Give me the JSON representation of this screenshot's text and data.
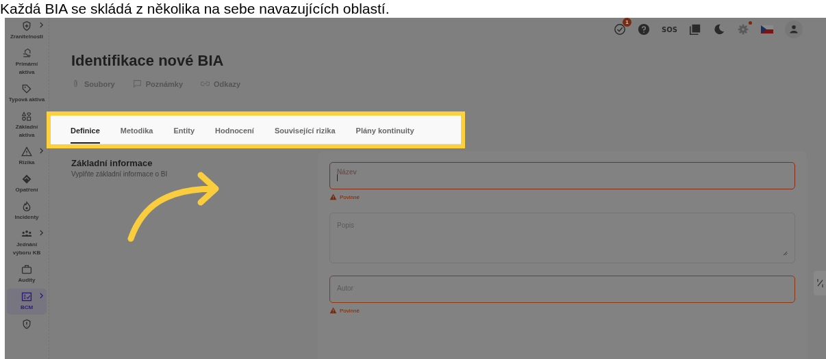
{
  "caption": "Každá BIA se skládá z několika na sebe navazujících oblastí.",
  "sidebar": {
    "items": [
      {
        "label": "Zranitelnosti",
        "kind": "shield-plus",
        "expandable": true,
        "selected": false
      },
      {
        "label": "Primární aktiva",
        "kind": "hand-house",
        "expandable": false,
        "selected": false
      },
      {
        "label": "Typová aktiva",
        "kind": "tag",
        "expandable": false,
        "selected": false
      },
      {
        "label": "Základní aktiva",
        "kind": "shapes",
        "expandable": false,
        "selected": false
      },
      {
        "label": "Rizika",
        "kind": "warning",
        "expandable": true,
        "selected": false
      },
      {
        "label": "Opatření",
        "kind": "handshake",
        "expandable": false,
        "selected": false
      },
      {
        "label": "Incidenty",
        "kind": "flame",
        "expandable": false,
        "selected": false
      },
      {
        "label": "Jednání výboru KB",
        "kind": "people",
        "expandable": true,
        "selected": false
      },
      {
        "label": "Audity",
        "kind": "briefcase",
        "expandable": false,
        "selected": false
      },
      {
        "label": "BCM",
        "kind": "checklist",
        "expandable": true,
        "selected": true
      },
      {
        "kind": "shield-alert",
        "expandable": false,
        "selected": false
      }
    ]
  },
  "topbar": {
    "tasks_badge": "1",
    "sos": "SOS",
    "settings_notification": true
  },
  "page": {
    "title": "Identifikace nové BIA",
    "links": [
      {
        "label": "Soubory",
        "kind": "paperclip"
      },
      {
        "label": "Poznámky",
        "kind": "comment"
      },
      {
        "label": "Odkazy",
        "kind": "link"
      }
    ]
  },
  "tabs": [
    {
      "label": "Definice",
      "selected": true
    },
    {
      "label": "Metodika",
      "selected": false
    },
    {
      "label": "Entity",
      "selected": false
    },
    {
      "label": "Hodnocení",
      "selected": false
    },
    {
      "label": "Související rizika",
      "selected": false
    },
    {
      "label": "Plány kontinuity",
      "selected": false
    }
  ],
  "section": {
    "title": "Základní informace",
    "subtitle": "Vyplňte základní informace o BI"
  },
  "fields": [
    {
      "kind": "input",
      "label": "Název",
      "focused": true,
      "error": "Povinné"
    },
    {
      "kind": "textarea",
      "label": "Popis",
      "focused": false
    },
    {
      "kind": "input",
      "label": "Autor",
      "focused": false,
      "error": "Povinné"
    }
  ]
}
